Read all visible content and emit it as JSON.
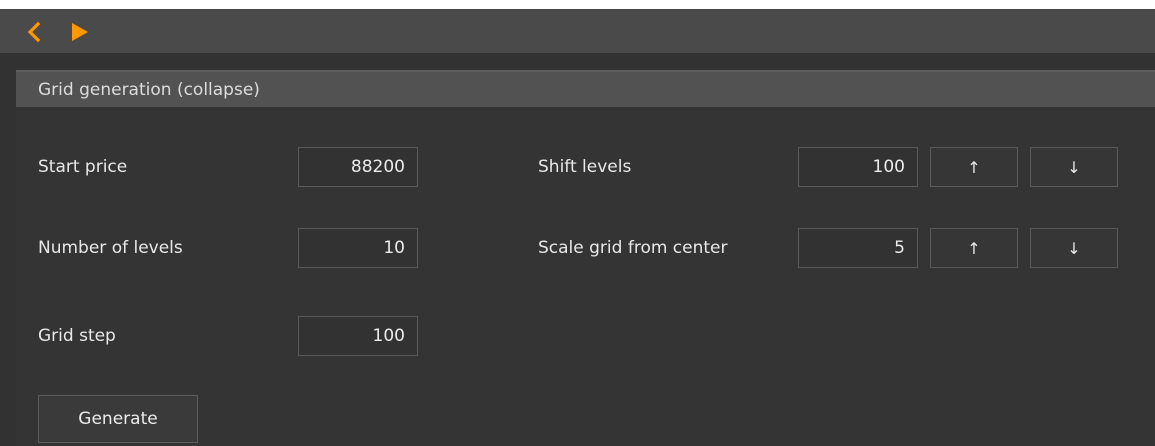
{
  "toolbar": {
    "back_icon": "chevron-left-icon",
    "forward_icon": "play-triangle-icon",
    "accent_color": "#ff9800"
  },
  "panel": {
    "title": "Grid generation (collapse)"
  },
  "form": {
    "start_price": {
      "label": "Start price",
      "value": "88200"
    },
    "number_of_levels": {
      "label": "Number of levels",
      "value": "10"
    },
    "grid_step": {
      "label": "Grid step",
      "value": "100"
    },
    "shift_levels": {
      "label": "Shift levels",
      "value": "100",
      "up_label": "↑",
      "down_label": "↓"
    },
    "scale_grid": {
      "label": "Scale grid from center",
      "value": "5",
      "up_label": "↑",
      "down_label": "↓"
    }
  },
  "generate_button": {
    "label": "Generate"
  }
}
